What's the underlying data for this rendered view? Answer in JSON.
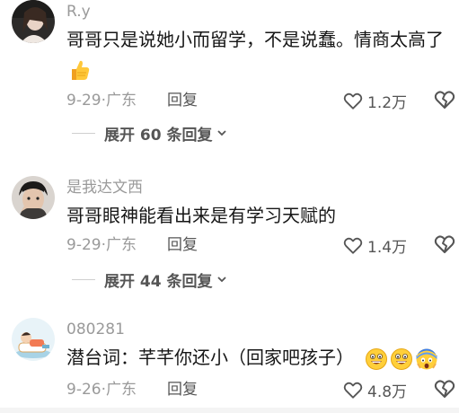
{
  "comments": [
    {
      "username": "R.y",
      "text": "哥哥只是说她小而留学，不是说蠢。情商太高了",
      "date": "9-29",
      "location": "广东",
      "reply_label": "回复",
      "likes": "1.2万",
      "expand_label": "展开 60 条回复",
      "avatar_icon": "portrait-photo",
      "text_emoji": "thumbs-up-icon"
    },
    {
      "username": "是我达文西",
      "text": "哥哥眼神能看出来是有学习天赋的",
      "date": "9-29",
      "location": "广东",
      "reply_label": "回复",
      "likes": "1.4万",
      "expand_label": "展开 44 条回复",
      "avatar_icon": "portrait-photo"
    },
    {
      "username": "080281",
      "text": "潜台词：芊芊你还小（回家吧孩子）",
      "date": "9-26",
      "location": "广东",
      "reply_label": "回复",
      "likes": "4.8万",
      "avatar_icon": "cartoon-reclining-figure",
      "text_emoji": [
        "grin-emoji",
        "grin-emoji",
        "scream-emoji"
      ]
    }
  ],
  "colors": {
    "text": "#161616",
    "muted": "#9a9a9a",
    "action": "#555555"
  }
}
